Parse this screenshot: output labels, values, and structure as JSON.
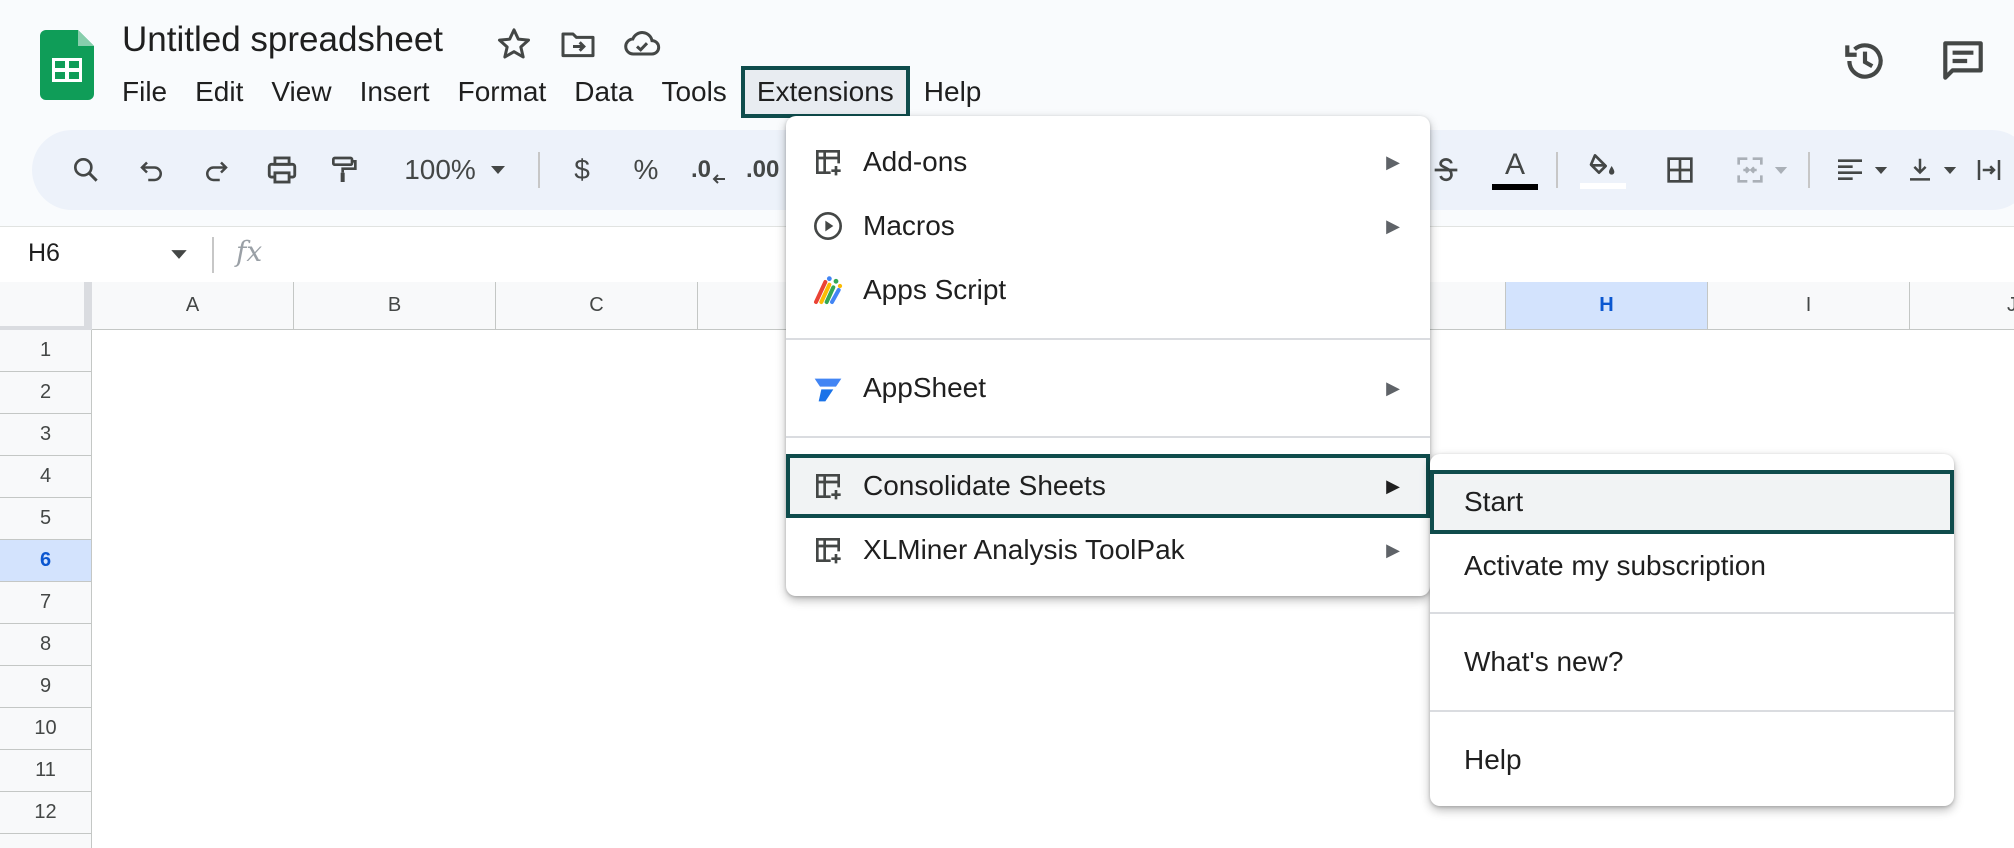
{
  "document": {
    "title": "Untitled spreadsheet"
  },
  "menubar": {
    "items": [
      "File",
      "Edit",
      "View",
      "Insert",
      "Format",
      "Data",
      "Tools",
      "Extensions",
      "Help"
    ],
    "active": "Extensions"
  },
  "toolbar": {
    "zoom": "100%",
    "currency": "$",
    "percent": "%",
    "decrease_decimal": ".0",
    "increase_decimal": ".00",
    "text_color_letter": "A"
  },
  "formula_bar": {
    "cell_ref": "H6",
    "fx": "fx"
  },
  "grid": {
    "columns": [
      "A",
      "B",
      "C",
      "H",
      "I",
      "J"
    ],
    "rows": [
      "1",
      "2",
      "3",
      "4",
      "5",
      "6",
      "7",
      "8",
      "9",
      "10",
      "11",
      "12"
    ],
    "selected_column": "H",
    "selected_row": "6"
  },
  "extensions_menu": {
    "items": [
      {
        "label": "Add-ons",
        "icon": "add-ons-icon",
        "submenu": true
      },
      {
        "label": "Macros",
        "icon": "play-circle-icon",
        "submenu": true
      },
      {
        "label": "Apps Script",
        "icon": "apps-script-icon",
        "submenu": false
      },
      {
        "label": "AppSheet",
        "icon": "appsheet-icon",
        "submenu": true
      },
      {
        "label": "Consolidate Sheets",
        "icon": "add-on-table-icon",
        "submenu": true,
        "highlighted": true
      },
      {
        "label": "XLMiner Analysis ToolPak",
        "icon": "add-on-table-icon",
        "submenu": true
      }
    ],
    "submenu_arrow": "▶"
  },
  "consolidate_submenu": {
    "items": [
      {
        "label": "Start",
        "highlighted": true
      },
      {
        "label": "Activate my subscription"
      },
      {
        "label": "What's new?"
      },
      {
        "label": "Help"
      }
    ]
  },
  "colors": {
    "accent_outline": "#0f4c4c",
    "selection_blue": "#d3e3fd",
    "sheets_green": "#0f9d58"
  }
}
